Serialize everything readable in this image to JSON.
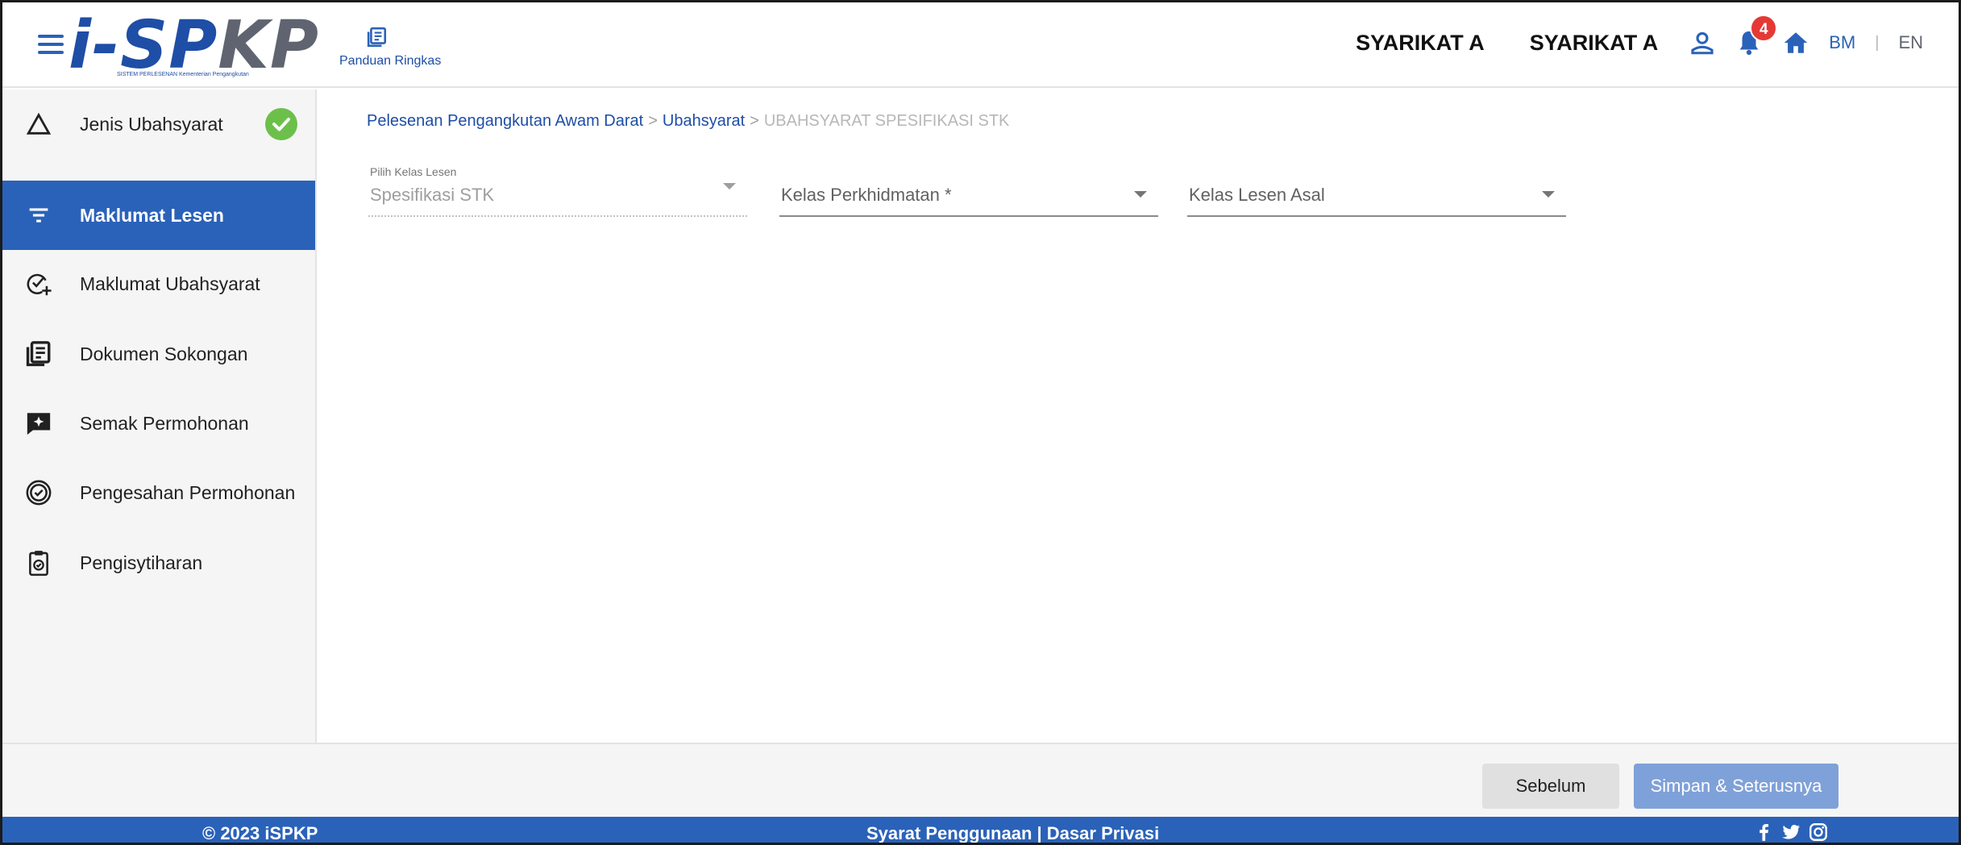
{
  "header": {
    "logo_text_i": "i-",
    "logo_text_sp": "SP",
    "logo_text_kp": "KP",
    "logo_subtitle": "SISTEM PERLESENAN Kementerian Pengangkutan",
    "guide_label": "Panduan Ringkas",
    "company_1": "SYARIKAT A",
    "company_2": "SYARIKAT A",
    "notification_count": "4",
    "lang_bm": "BM",
    "lang_sep": "|",
    "lang_en": "EN"
  },
  "sidebar": {
    "items": [
      {
        "label": "Jenis Ubahsyarat",
        "icon": "triangle-icon",
        "completed": true
      },
      {
        "label": "Maklumat Lesen",
        "icon": "filter-list-icon",
        "active": true
      },
      {
        "label": "Maklumat Ubahsyarat",
        "icon": "check-add-icon"
      },
      {
        "label": "Dokumen Sokongan",
        "icon": "document-list-icon"
      },
      {
        "label": "Semak Permohonan",
        "icon": "review-chat-icon"
      },
      {
        "label": "Pengesahan Permohonan",
        "icon": "verified-badge-icon"
      },
      {
        "label": "Pengisytiharan",
        "icon": "clipboard-check-icon"
      }
    ]
  },
  "breadcrumb": {
    "item_1": "Pelesenan Pengangkutan Awam Darat",
    "sep_1": ">",
    "item_2": "Ubahsyarat",
    "sep_2": ">",
    "current": "UBAHSYARAT SPESIFIKASI STK"
  },
  "form": {
    "kelas_lesen_label": "Pilih Kelas Lesen",
    "kelas_lesen_value": "Spesifikasi STK",
    "kelas_perkhidmatan_placeholder": "Kelas Perkhidmatan *",
    "kelas_lesen_asal_placeholder": "Kelas Lesen Asal"
  },
  "actions": {
    "prev_label": "Sebelum",
    "next_label": "Simpan & Seterusnya"
  },
  "footer": {
    "copyright": "© 2023 iSPKP",
    "terms": "Syarat Penggunaan",
    "sep": "|",
    "privacy": "Dasar Privasi"
  },
  "colors": {
    "primary": "#2a62b9",
    "success": "#6cc04a",
    "badge": "#e53935",
    "disabled_button": "#7fa1d9"
  }
}
